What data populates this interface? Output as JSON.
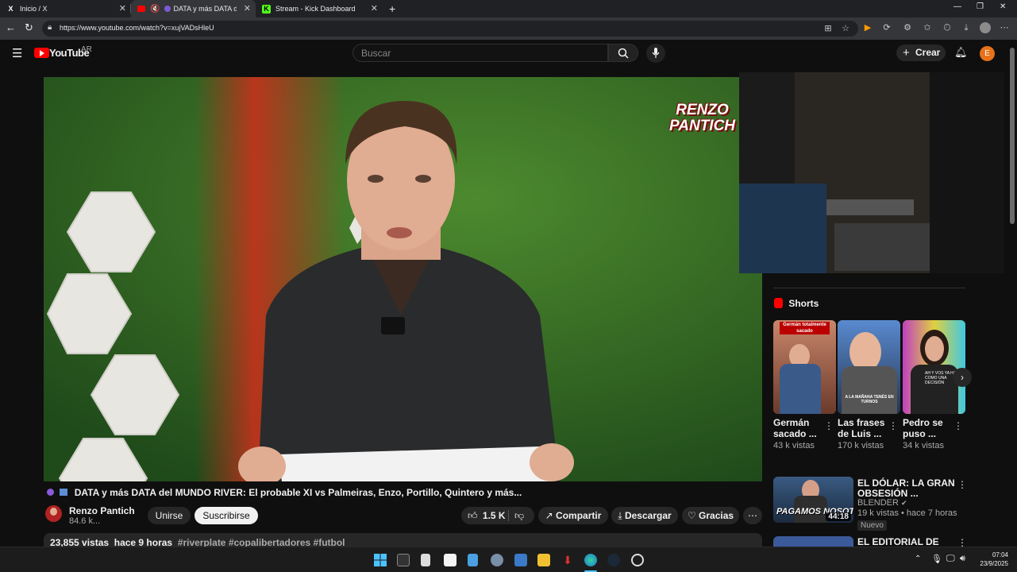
{
  "browser": {
    "tabs": [
      {
        "label": "Inicio / X",
        "favicon": "X"
      },
      {
        "label": "DATA y más DATA del",
        "favicon": "YT"
      },
      {
        "label": "Stream - Kick Dashboard",
        "favicon": "K"
      }
    ],
    "url": "https://www.youtube.com/watch?v=xujVADsHleU",
    "new_tab": "+"
  },
  "youtube": {
    "logo_text": "YouTube",
    "region": "AR",
    "search_placeholder": "Buscar",
    "create_label": "Crear",
    "avatar_letter": "E"
  },
  "video": {
    "overlay_brand_line1": "RENZO",
    "overlay_brand_line2": "PANTICH",
    "title": "DATA y más DATA del MUNDO RIVER: El probable XI vs Palmeiras, Enzo, Portillo, Quintero y más...",
    "channel_name": "Renzo Pantich",
    "subscribers": "84.6 k...",
    "join_label": "Unirse",
    "subscribe_label": "Suscribirse",
    "likes": "1.5 K",
    "share_label": "Compartir",
    "download_label": "Descargar",
    "thanks_label": "Gracias",
    "views": "23,855 vistas",
    "age": "hace 9 horas",
    "hashtags": "#riverplate #copalibertadores #futbol"
  },
  "sidebar": {
    "shorts_title": "Shorts",
    "shorts": [
      {
        "title": "Germán sacado ...",
        "views": "43 k vistas",
        "thumb_caption": "Germán totalmente sacado"
      },
      {
        "title": "Las frases de Luis ...",
        "views": "170 k vistas",
        "thumb_caption": "A LA MAÑANA TENÉS EN TURNOS"
      },
      {
        "title": "Pedro se puso ...",
        "views": "34 k vistas",
        "thumb_caption": "AH Y VOS YA HAS COMO UNA DECISIÓN"
      }
    ],
    "videos": [
      {
        "title": "EL DÓLAR: LA GRAN OBSESIÓN ...",
        "channel": "BLENDER",
        "meta": "19 k vistas • hace 7 horas",
        "badge": "Nuevo",
        "duration": "44:18",
        "thumb_text": "PAGAMOS NOSOTROS"
      },
      {
        "title": "EL EDITORIAL DE"
      }
    ]
  },
  "taskbar": {
    "time": "07:04",
    "date": "23/9/2025"
  }
}
